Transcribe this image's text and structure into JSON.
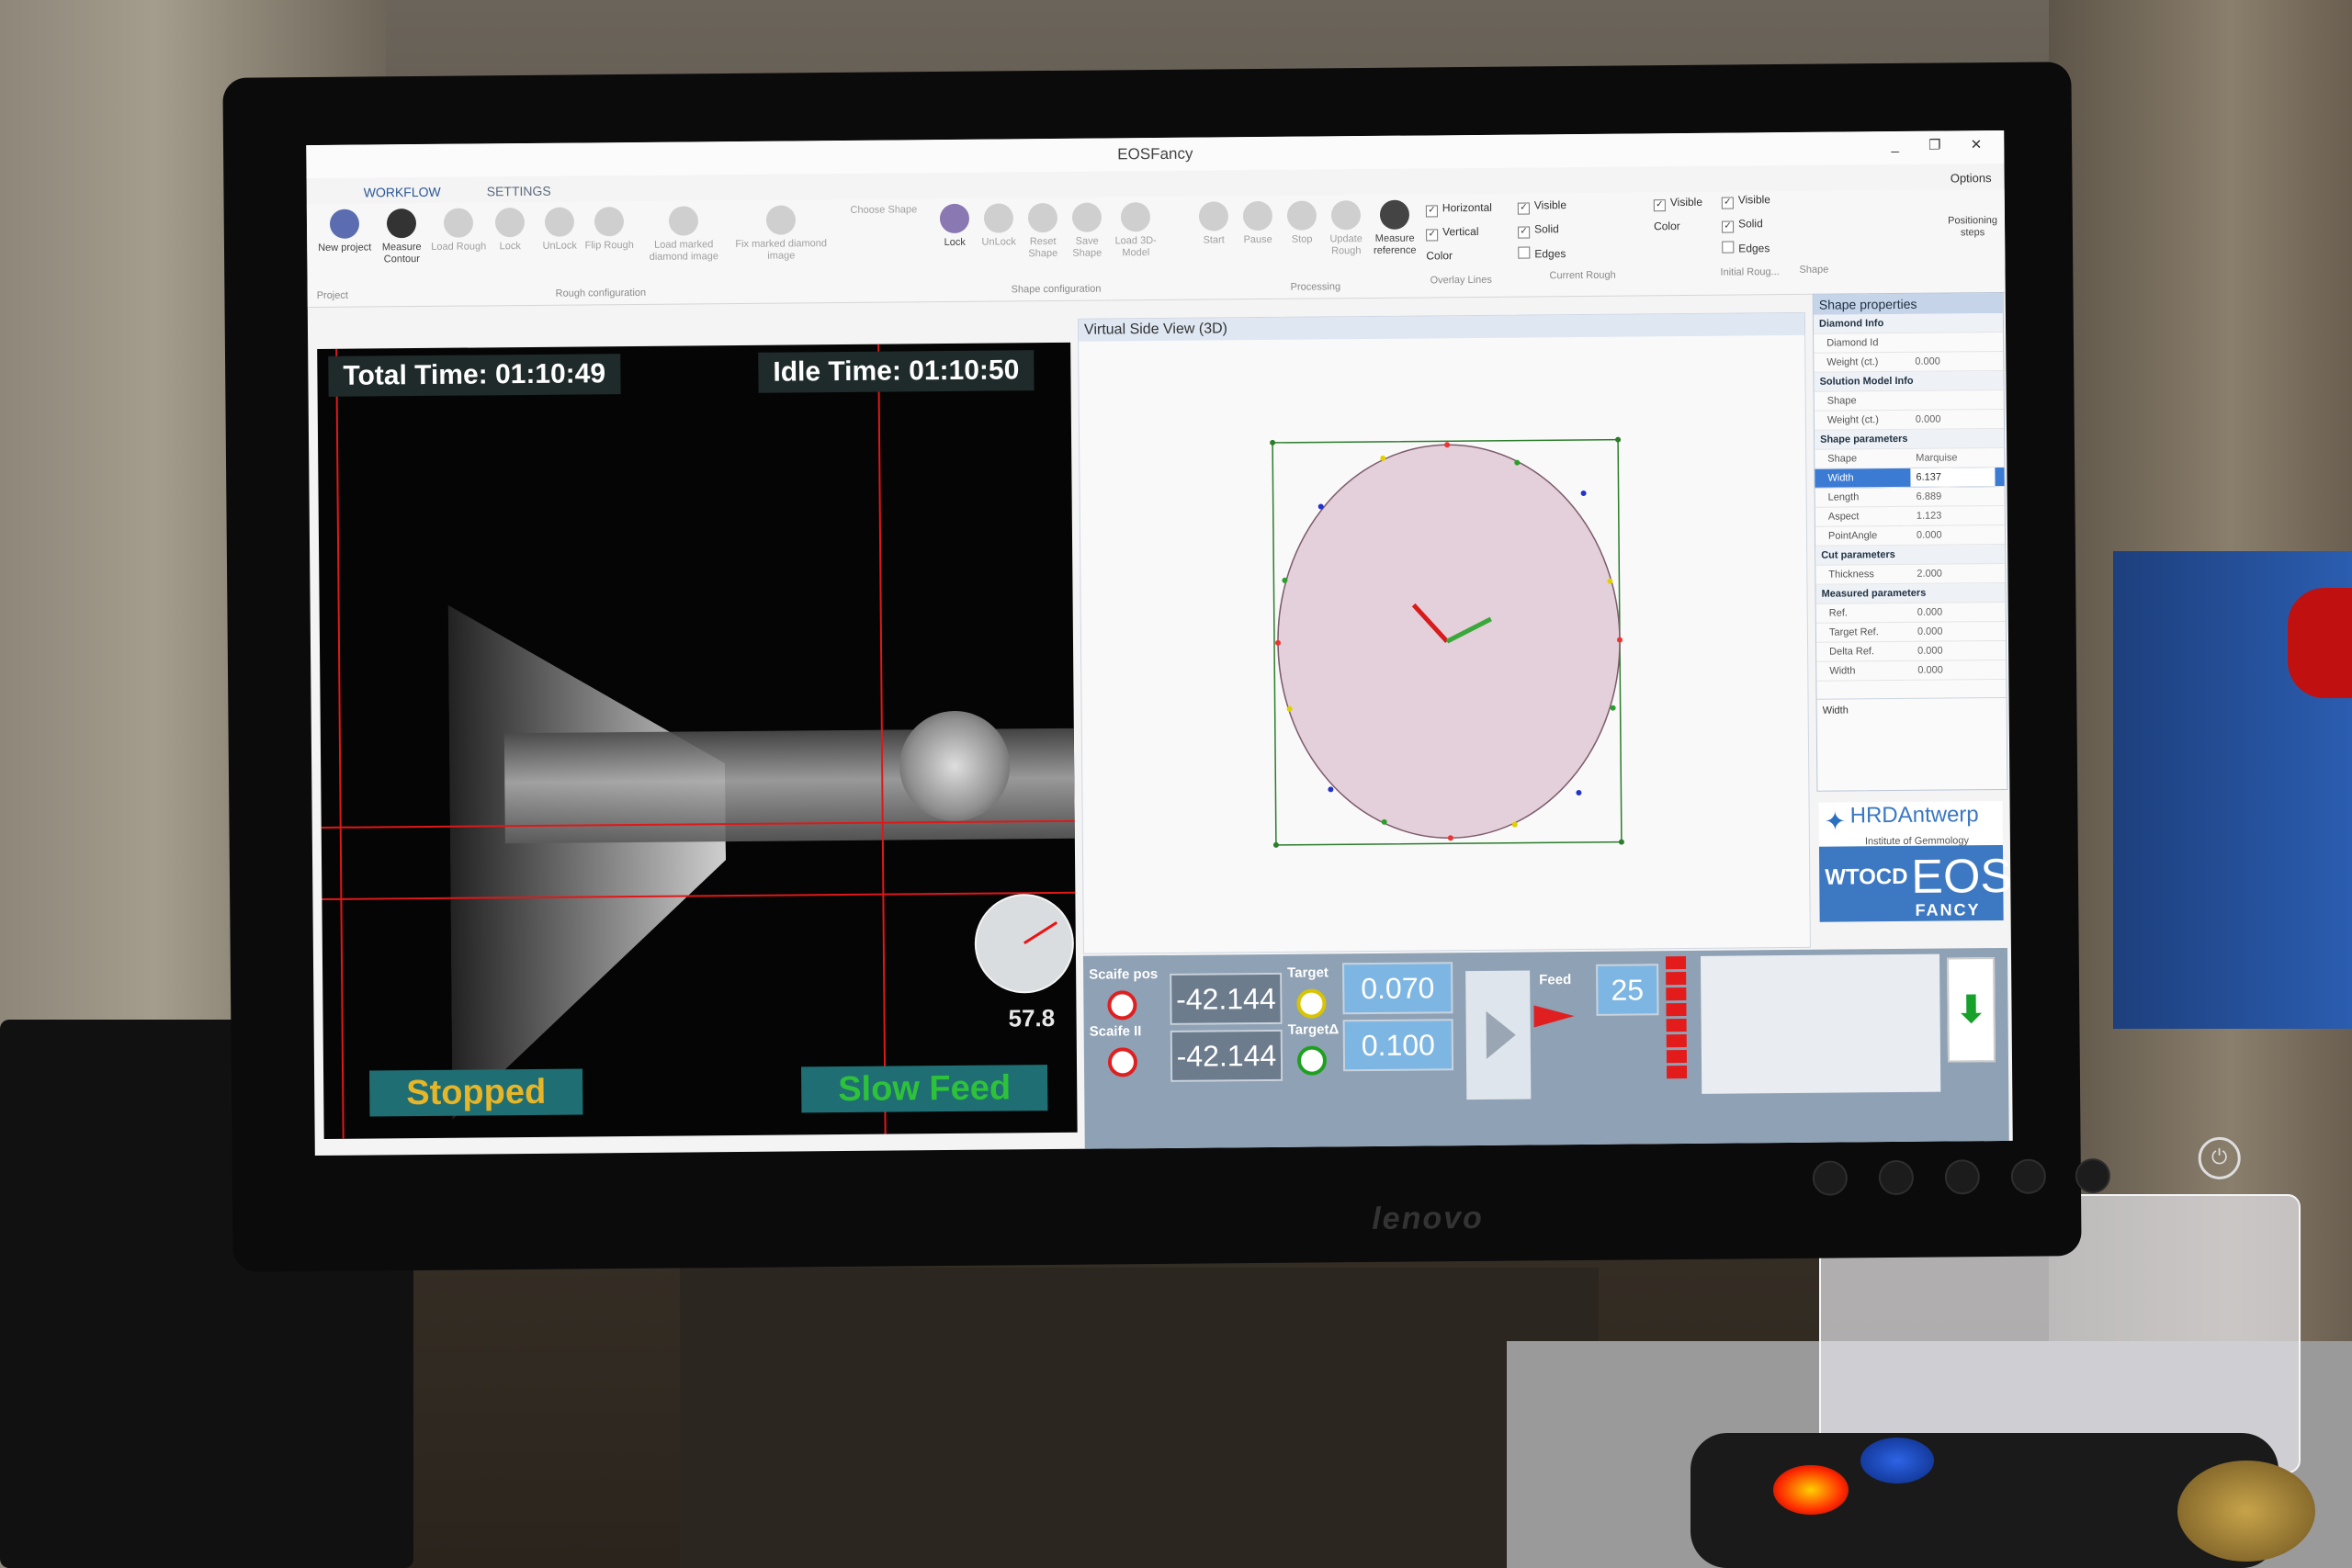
{
  "window": {
    "title": "EOSFancy",
    "options_label": "Options",
    "controls": "_ ❐ ✕"
  },
  "tabs": [
    {
      "label": "WORKFLOW"
    },
    {
      "label": "SETTINGS"
    }
  ],
  "ribbon": {
    "buttons": [
      {
        "label": "New project"
      },
      {
        "label": "Measure Contour"
      },
      {
        "label": "Load Rough"
      },
      {
        "label": "Lock"
      },
      {
        "label": "UnLock"
      },
      {
        "label": "Flip Rough"
      },
      {
        "label": "Load marked diamond image"
      },
      {
        "label": "Fix marked diamond image"
      },
      {
        "label": "Choose Shape"
      },
      {
        "label": "Lock"
      },
      {
        "label": "UnLock"
      },
      {
        "label": "Reset Shape"
      },
      {
        "label": "Save Shape"
      },
      {
        "label": "Load 3D-Model"
      },
      {
        "label": "Start"
      },
      {
        "label": "Pause"
      },
      {
        "label": "Stop"
      },
      {
        "label": "Update Rough"
      },
      {
        "label": "Measure reference"
      },
      {
        "label": "Positioning steps"
      }
    ],
    "groups": {
      "project": "Project",
      "rough": "Rough configuration",
      "shape": "Shape configuration",
      "processing": "Processing",
      "overlay": "Overlay Lines",
      "current": "Current Rough",
      "initial": "Initial Roug...",
      "shape2": "Shape"
    },
    "checks": {
      "horizontal": "Horizontal",
      "vertical": "Vertical",
      "color": "Color",
      "visible": "Visible",
      "solid": "Solid",
      "edges": "Edges"
    }
  },
  "camera": {
    "total_time": "Total Time:  01:10:49",
    "idle_time": "Idle Time:  01:10:50",
    "gauge_value": "57.8",
    "status_left": "Stopped",
    "status_right": "Slow Feed"
  },
  "virtual_view": {
    "title": "Virtual Side View (3D)"
  },
  "shape_properties": {
    "title": "Shape properties",
    "rows": [
      {
        "type": "sec",
        "label": "Diamond Info"
      },
      {
        "type": "row",
        "label": "Diamond Id",
        "value": ""
      },
      {
        "type": "row",
        "label": "Weight (ct.)",
        "value": "0.000"
      },
      {
        "type": "sec",
        "label": "Solution Model Info"
      },
      {
        "type": "row",
        "label": "Shape",
        "value": ""
      },
      {
        "type": "row",
        "label": "Weight (ct.)",
        "value": "0.000"
      },
      {
        "type": "sec",
        "label": "Shape parameters"
      },
      {
        "type": "row",
        "label": "Shape",
        "value": "Marquise"
      },
      {
        "type": "sel",
        "label": "Width",
        "value": "6.137"
      },
      {
        "type": "row",
        "label": "Length",
        "value": "6.889"
      },
      {
        "type": "row",
        "label": "Aspect",
        "value": "1.123"
      },
      {
        "type": "row",
        "label": "PointAngle",
        "value": "0.000"
      },
      {
        "type": "sec",
        "label": "Cut parameters"
      },
      {
        "type": "row",
        "label": "Thickness",
        "value": "2.000"
      },
      {
        "type": "sec",
        "label": "Measured parameters"
      },
      {
        "type": "row",
        "label": "Ref.",
        "value": "0.000"
      },
      {
        "type": "row",
        "label": "Target Ref.",
        "value": "0.000"
      },
      {
        "type": "row",
        "label": "Delta Ref.",
        "value": "0.000"
      },
      {
        "type": "row",
        "label": "Width",
        "value": "0.000"
      }
    ],
    "description": "Width"
  },
  "logos": {
    "hrd": "HRDAntwerp",
    "hrd_sub": "Institute of Gemmology",
    "wtocd": "WTOCD",
    "eos": "EOS",
    "fancy": "FANCY"
  },
  "bottom": {
    "scaife_pos_label": "Scaife pos",
    "scaife_pos_value": "-42.144",
    "scaife_ii_label": "Scaife II",
    "scaife_ii_value": "-42.144",
    "target_label": "Target",
    "target_value": "0.070",
    "target_delta_label": "TargetΔ",
    "target_delta_value": "0.100",
    "feed_label": "Feed",
    "feed_value": "25"
  },
  "monitor": {
    "brand": "lenovo"
  }
}
